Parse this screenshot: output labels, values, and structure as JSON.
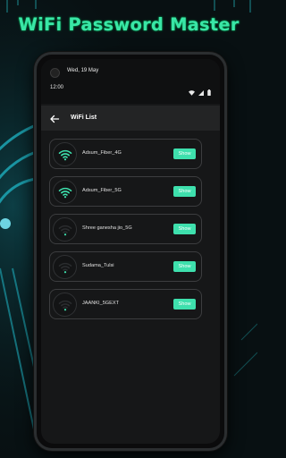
{
  "promo": {
    "title": "WiFi Password Master"
  },
  "lockscreen": {
    "date": "Wed, 19 May",
    "time": "12:00"
  },
  "appbar": {
    "title": "WiFi List"
  },
  "colors": {
    "accent": "#3ee0ad",
    "background": "#161718",
    "card_border": "#3c3d3f"
  },
  "networks": [
    {
      "name": "Adsum_Fiber_4G",
      "button": "Show",
      "signal_icon": "wifi-strong-icon"
    },
    {
      "name": "Adsum_Fiber_5G",
      "button": "Show",
      "signal_icon": "wifi-strong-icon"
    },
    {
      "name": "Shree ganesha jio_5G",
      "button": "Show",
      "signal_icon": "wifi-weak-icon"
    },
    {
      "name": "Sudama_Tulsi",
      "button": "Show",
      "signal_icon": "wifi-weak-icon"
    },
    {
      "name": "JAANKI_5GEXT",
      "button": "Show",
      "signal_icon": "wifi-weak-icon"
    }
  ]
}
